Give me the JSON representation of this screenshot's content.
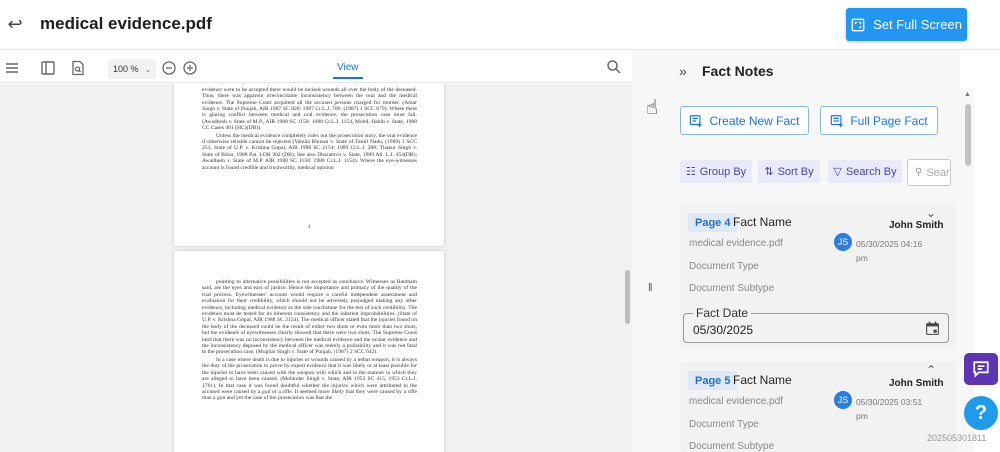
{
  "header": {
    "title": "medical evidence.pdf",
    "fullscreen_label": "Set Full Screen"
  },
  "toolbar": {
    "zoom": "100 %",
    "view_tab": "View"
  },
  "document": {
    "page1_paragraphs": [
      "out and abrasions on the deceased, not a single incised wound was found on the body of the deceased, and only abrasions, contusions and fractures were found, it was held that if the oral evidence were to be accepted there would be incised wounds all over the body of the deceased. Thus, there was apparent irreconcilable inconsistency between the oral and the medical evidence. The Supreme Court acquitted all the accused persons charged for murder. (Amar Singh v. State of Punjab, AIR 1987 SC 826: 1987 Cr.L.J. 706: (1987) 1 SCC 679). Where there is glaring conflict between medical and oral evidence, the prosecution case must fail. (Awadhesh v. State of M.P., AIR 1988 SC 1158: 1988 Cr.L.J. 1154, Mohd. Habib v. State, 1988 CC Cases 401 (HC)(DB)).",
      "Unless the medical evidence completely rules out the prosecution story, the oral evidence if otherwise reliable cannot be rejected (Vahula Bhusan v. State of Tamil Nadu, (1989) 1 SCC 253, State of U.P. v. Krishna Gopal, AIR 1988 SC 2154: 1989 Cr.L.J. 288; Thakur Singh v. State of Bihar, 1988 Pat. LOR 302 (DB); See also Dharamvir v. State, 1989 All. L.J. 454(DB); Awadhesh v. State of M.P. AIR 1988 SC 1158: 1988 Cr.L.J. 1154). Where the eye-witnesses account is found credible and trustworthy, medical opinion"
    ],
    "page1_number": "4",
    "page2_paragraphs": [
      "pointing to alternative possibilities is not accepted as conclusive. Witnesses as Bantham said, are the eyes and ears of justice. Hence the importance and primacy of the quality of the trial process. Eyewitnesses' account would require a careful independent assessment and evaluation for their credibility, which should not be adversely prejudged making any other evidence, including medical evidence as the sole touchstone for the test of such credibility. The evidence must be tested for its inherent consistency and the inherent improbabilities. (State of U.P. v. Krishna Gopal, AIR 1988 SC 2154). The medical officer stated that the injuries found on the body of the deceased could be the result of either two shots or even more than two shots, but the evidence of eyewitnesses clearly showed that there were two shots. The Supreme Court held that there was no inconsistency between the medical evidence and the ocular evidence and the inconsistency deposed by the medical officer was merely a probability and it was not fatal to the prosecution case. (Mughar Singh v. State of Punjab, (1987) 2 SCC 642).",
      "In a case where death is due to injuries or wounds caused by a lethal weapon, it is always the duty of the prosecution to prove by expert evidence that it was likely or at least possible for the injuries to have been caused with the weapon with which and in the manner in which they are alleged to have been caused. (Mohinder Singh v. State, AIR 1953 SC 415, 1953 Cr.L.J. 1761). In that case it was found doubtful whether the injuries which were attributed to the accused were caused by a gun or a rifle. It seemed more likely that they were caused by a rifle than a gun and yet the case of the prosecution was that the"
    ]
  },
  "panel": {
    "title": "Fact Notes",
    "create_label": "Create New Fact",
    "fullpage_label": "Full Page Fact",
    "group_label": "Group By",
    "sort_label": "Sort By",
    "search_label": "Search By",
    "search_placeholder": "Search Fact",
    "cards": [
      {
        "page": "Page 4",
        "name": "Fact Name",
        "author": "John Smith",
        "initials": "JS",
        "timestamp": "05/30/2025 04:16 pm",
        "file": "medical evidence.pdf",
        "doc_type": "Document Type",
        "doc_subtype": "Document Subtype",
        "date_label": "Fact Date",
        "date_value": "05/30/2025"
      },
      {
        "page": "Page 5",
        "name": "Fact Name",
        "author": "John Smith",
        "initials": "JS",
        "timestamp": "05/30/2025 03:51 pm",
        "file": "medical evidence.pdf",
        "doc_type": "Document Type",
        "doc_subtype": "Document Subtype"
      }
    ]
  },
  "build_id": "202505301811",
  "colors": {
    "primary": "#2196f3",
    "chip_text": "#4a47a3",
    "chat_fab": "#5e35b1",
    "help_fab": "#1e9be9"
  }
}
